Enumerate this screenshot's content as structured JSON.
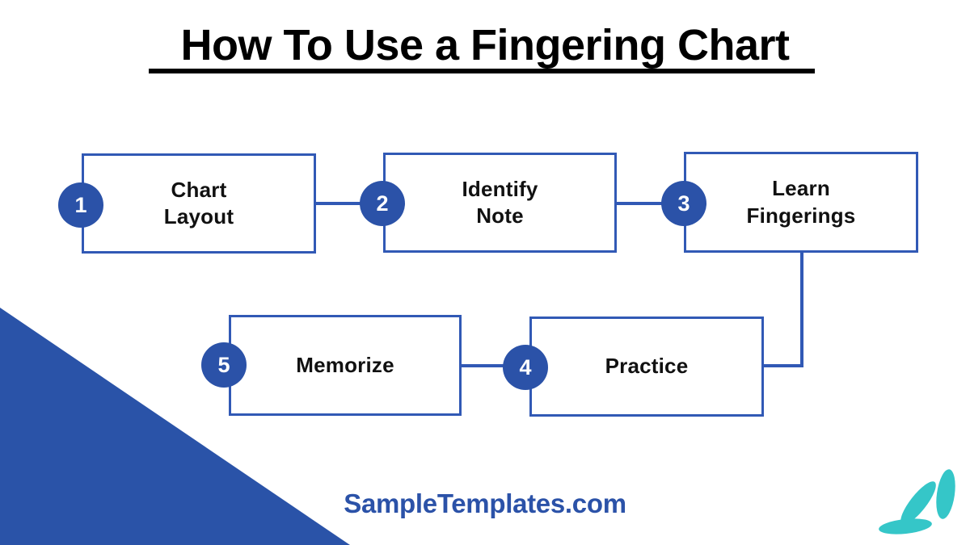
{
  "header": {
    "title": "How To Use a Fingering Chart"
  },
  "diagram": {
    "type": "numbered-step-flowchart",
    "steps": [
      {
        "number": "1",
        "label": "Chart\nLayout"
      },
      {
        "number": "2",
        "label": "Identify\nNote"
      },
      {
        "number": "3",
        "label": "Learn\nFingerings"
      },
      {
        "number": "4",
        "label": "Practice"
      },
      {
        "number": "5",
        "label": "Memorize"
      }
    ]
  },
  "footer": {
    "brand": "SampleTemplates.com"
  },
  "decor": {
    "triangle_name": "blue-corner-triangle",
    "petals_name": "teal-petal-cluster"
  },
  "colors": {
    "circle_blue": "#2b52a8",
    "box_border_blue": "#3159b5",
    "connector_blue": "#3159b5",
    "triangle_blue": "#2a53a8",
    "petal_teal": "#35c6c8",
    "title_black": "#000000",
    "brand_blue": "#2b52a8",
    "background": "#ffffff"
  }
}
